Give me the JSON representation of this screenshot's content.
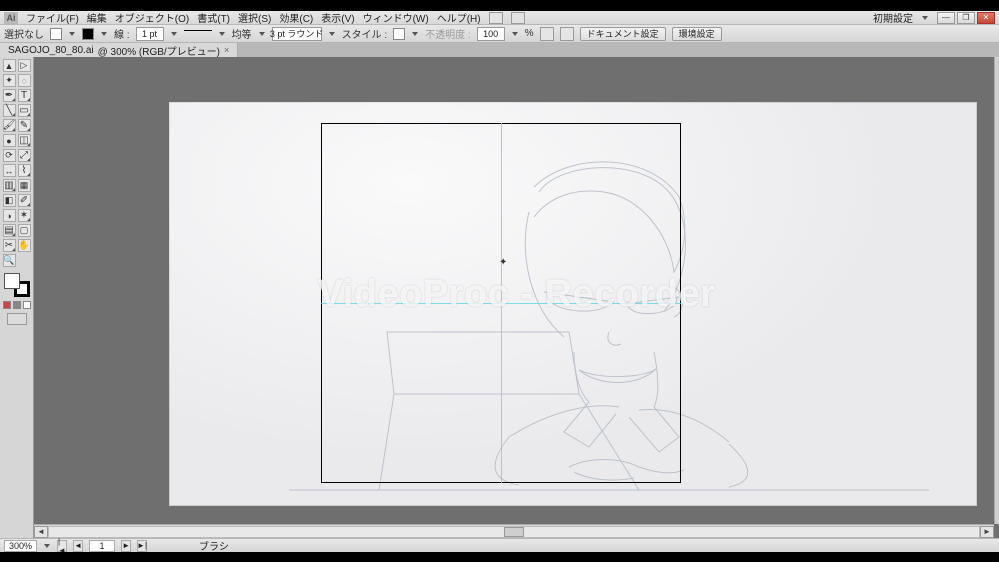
{
  "app_logo": "Ai",
  "menus": {
    "file": "ファイル(F)",
    "edit": "編集",
    "object": "オブジェクト(O)",
    "type": "書式(T)",
    "select": "選択(S)",
    "effect": "効果(C)",
    "view": "表示(V)",
    "window": "ウィンドウ(W)",
    "help": "ヘルプ(H)"
  },
  "menubar_right": "初期設定",
  "controlbar": {
    "selection": "選択なし",
    "line_label": "線 :",
    "stroke_weight": "1 pt",
    "uniform": "均等",
    "brush_def": "3 pt ラウンド",
    "style_label": "スタイル :",
    "opacity_label": "不透明度 :",
    "opacity_value": "100",
    "percent": "%",
    "doc_setup": "ドキュメント設定",
    "env_setup": "環境設定"
  },
  "tab": {
    "filename": "SAGOJO_80_80.ai",
    "zoom_mode": "@ 300% (RGB/プレビュー)"
  },
  "watermark": "VideoProc - Recorder",
  "status": {
    "zoom": "300%",
    "nav_val": "1",
    "tool_name": "ブラシ"
  },
  "tool_glyphs": {
    "selection": "▲",
    "direct": "▷",
    "wand": "✦",
    "lasso": "◌",
    "pen": "✒",
    "type": "T",
    "line": "╲",
    "rect": "▭",
    "brush": "🖌",
    "pencil": "✎",
    "blob": "●",
    "eraser": "◫",
    "rotate": "⟳",
    "scale": "⤢",
    "width": "↔",
    "warp": "⌇",
    "shape": "▥",
    "mesh": "▦",
    "gradient": "◧",
    "eyedrop": "✐",
    "blend": "◑",
    "symbol": "✶",
    "graph": "▤",
    "artboard": "▢",
    "slice": "✂",
    "hand": "✋",
    "zoom": "🔍",
    "spacer": ""
  }
}
